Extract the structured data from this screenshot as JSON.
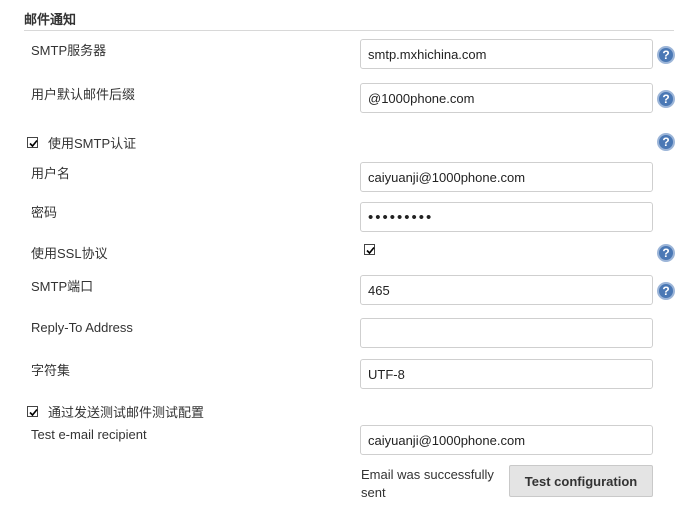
{
  "section": {
    "title": "邮件通知"
  },
  "smtp_server": {
    "label": "SMTP服务器",
    "value": "smtp.mxhichina.com"
  },
  "default_suffix": {
    "label": "用户默认邮件后缀",
    "value": "@1000phone.com"
  },
  "smtp_auth": {
    "label": "使用SMTP认证",
    "checked": true
  },
  "username": {
    "label": "用户名",
    "value": "caiyuanji@1000phone.com"
  },
  "password": {
    "label": "密码",
    "value": "•••••••••"
  },
  "use_ssl": {
    "label": "使用SSL协议",
    "checked": true
  },
  "smtp_port": {
    "label": "SMTP端口",
    "value": "465"
  },
  "reply_to": {
    "label": "Reply-To Address",
    "value": ""
  },
  "charset": {
    "label": "字符集",
    "value": "UTF-8"
  },
  "test_mail": {
    "label": "通过发送测试邮件测试配置",
    "checked": true
  },
  "test_recipient": {
    "label": "Test e-mail recipient",
    "value": "caiyuanji@1000phone.com"
  },
  "test_result": {
    "status": "Email was successfully sent",
    "button_label": "Test configuration"
  },
  "help": {
    "glyph": "?"
  },
  "colors": {
    "help_icon": "#4a78b5",
    "button_bg": "#e4e4e4",
    "border": "#cfcfcf"
  }
}
